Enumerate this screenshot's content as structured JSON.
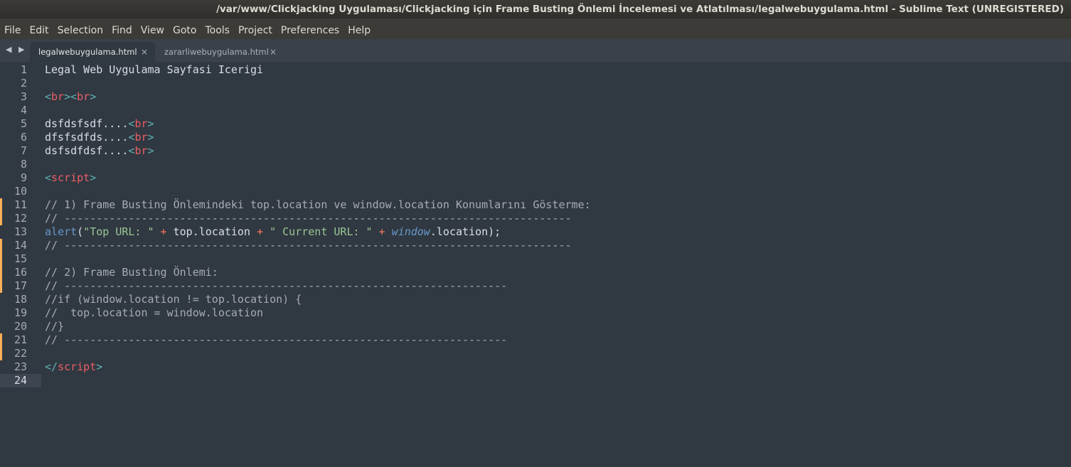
{
  "window": {
    "title": "/var/www/Clickjacking Uygulaması/Clickjacking için Frame Busting Önlemi İncelemesi ve Atlatılması/legalwebuygulama.html - Sublime Text (UNREGISTERED)"
  },
  "menu": [
    "File",
    "Edit",
    "Selection",
    "Find",
    "View",
    "Goto",
    "Tools",
    "Project",
    "Preferences",
    "Help"
  ],
  "nav": {
    "arrows": "◀ ▶"
  },
  "tabs": [
    {
      "label": "legalwebuygulama.html",
      "close": "×",
      "active": true
    },
    {
      "label": "zararliwebuygulama.html",
      "close": "×",
      "active": false
    }
  ],
  "editor": {
    "current_line": 24,
    "modified_lines": [
      11,
      12,
      14,
      15,
      16,
      17,
      21,
      22
    ],
    "colors": {
      "background": "#303841",
      "tag": "#ec5f67",
      "bracket": "#5fb3b3",
      "string": "#99c794",
      "operator": "#f97b58",
      "function": "#6699cc",
      "modified_marker": "#f9ae58"
    },
    "lines": [
      {
        "n": "1",
        "t": [
          [
            "Legal Web Uygulama Sayfasi Icerigi",
            "plain"
          ]
        ]
      },
      {
        "n": "2",
        "t": []
      },
      {
        "n": "3",
        "t": [
          [
            "<",
            "br"
          ],
          [
            "br",
            "tn"
          ],
          [
            "><",
            "br"
          ],
          [
            "br",
            "tn"
          ],
          [
            ">",
            "br"
          ]
        ]
      },
      {
        "n": "4",
        "t": []
      },
      {
        "n": "5",
        "t": [
          [
            "dsfdsfsdf....",
            "plain"
          ],
          [
            "<",
            "br"
          ],
          [
            "br",
            "tn"
          ],
          [
            ">",
            "br"
          ]
        ]
      },
      {
        "n": "6",
        "t": [
          [
            "dfsfsdfds....",
            "plain"
          ],
          [
            "<",
            "br"
          ],
          [
            "br",
            "tn"
          ],
          [
            ">",
            "br"
          ]
        ]
      },
      {
        "n": "7",
        "t": [
          [
            "dsfsdfdsf....",
            "plain"
          ],
          [
            "<",
            "br"
          ],
          [
            "br",
            "tn"
          ],
          [
            ">",
            "br"
          ]
        ]
      },
      {
        "n": "8",
        "t": []
      },
      {
        "n": "9",
        "t": [
          [
            "<",
            "br"
          ],
          [
            "script",
            "tn"
          ],
          [
            ">",
            "br"
          ]
        ]
      },
      {
        "n": "10",
        "t": []
      },
      {
        "n": "11",
        "t": [
          [
            "// 1) Frame Busting Önlemindeki top.location ve window.location Konumlarını Gösterme:",
            "cm"
          ]
        ]
      },
      {
        "n": "12",
        "t": [
          [
            "// -------------------------------------------------------------------------------",
            "cm"
          ]
        ]
      },
      {
        "n": "13",
        "t": [
          [
            "alert",
            "fn"
          ],
          [
            "(",
            "plain"
          ],
          [
            "\"Top URL: \"",
            "str"
          ],
          [
            " + ",
            "op"
          ],
          [
            "top.location",
            "plain"
          ],
          [
            " + ",
            "op"
          ],
          [
            "\" Current URL: \"",
            "str"
          ],
          [
            " + ",
            "op"
          ],
          [
            "window",
            "win"
          ],
          [
            ".location);",
            "plain"
          ]
        ]
      },
      {
        "n": "14",
        "t": [
          [
            "// -------------------------------------------------------------------------------",
            "cm"
          ]
        ]
      },
      {
        "n": "15",
        "t": []
      },
      {
        "n": "16",
        "t": [
          [
            "// 2) Frame Busting Önlemi:",
            "cm"
          ]
        ]
      },
      {
        "n": "17",
        "t": [
          [
            "// ---------------------------------------------------------------------",
            "cm"
          ]
        ]
      },
      {
        "n": "18",
        "t": [
          [
            "//if (window.location != top.location) {",
            "cm"
          ]
        ]
      },
      {
        "n": "19",
        "t": [
          [
            "//  top.location = window.location",
            "cm"
          ]
        ]
      },
      {
        "n": "20",
        "t": [
          [
            "//}",
            "cm"
          ]
        ]
      },
      {
        "n": "21",
        "t": [
          [
            "// ---------------------------------------------------------------------",
            "cm"
          ]
        ]
      },
      {
        "n": "22",
        "t": []
      },
      {
        "n": "23",
        "t": [
          [
            "</",
            "br"
          ],
          [
            "script",
            "tn"
          ],
          [
            ">",
            "br"
          ]
        ]
      },
      {
        "n": "24",
        "t": []
      }
    ]
  }
}
